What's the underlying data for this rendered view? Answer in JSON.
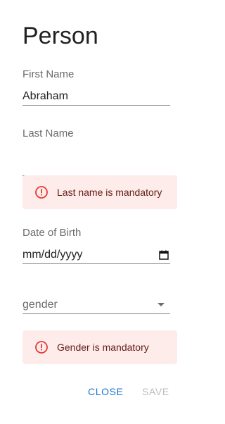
{
  "dialog": {
    "title": "Person"
  },
  "fields": {
    "first_name": {
      "label": "First Name",
      "value": "Abraham"
    },
    "last_name": {
      "label": "Last Name",
      "value": ""
    },
    "dob": {
      "label": "Date of Birth",
      "value": "mm/dd/yyyy"
    },
    "gender": {
      "placeholder": "gender"
    }
  },
  "errors": {
    "last_name": "Last name is mandatory",
    "gender": "Gender is mandatory"
  },
  "actions": {
    "close_label": "CLOSE",
    "save_label": "SAVE"
  },
  "colors": {
    "accent": "#1976d2",
    "error_bg": "#fdecea",
    "error_text": "#611a15",
    "error_icon": "#e53935",
    "disabled": "#bdbdbd"
  }
}
